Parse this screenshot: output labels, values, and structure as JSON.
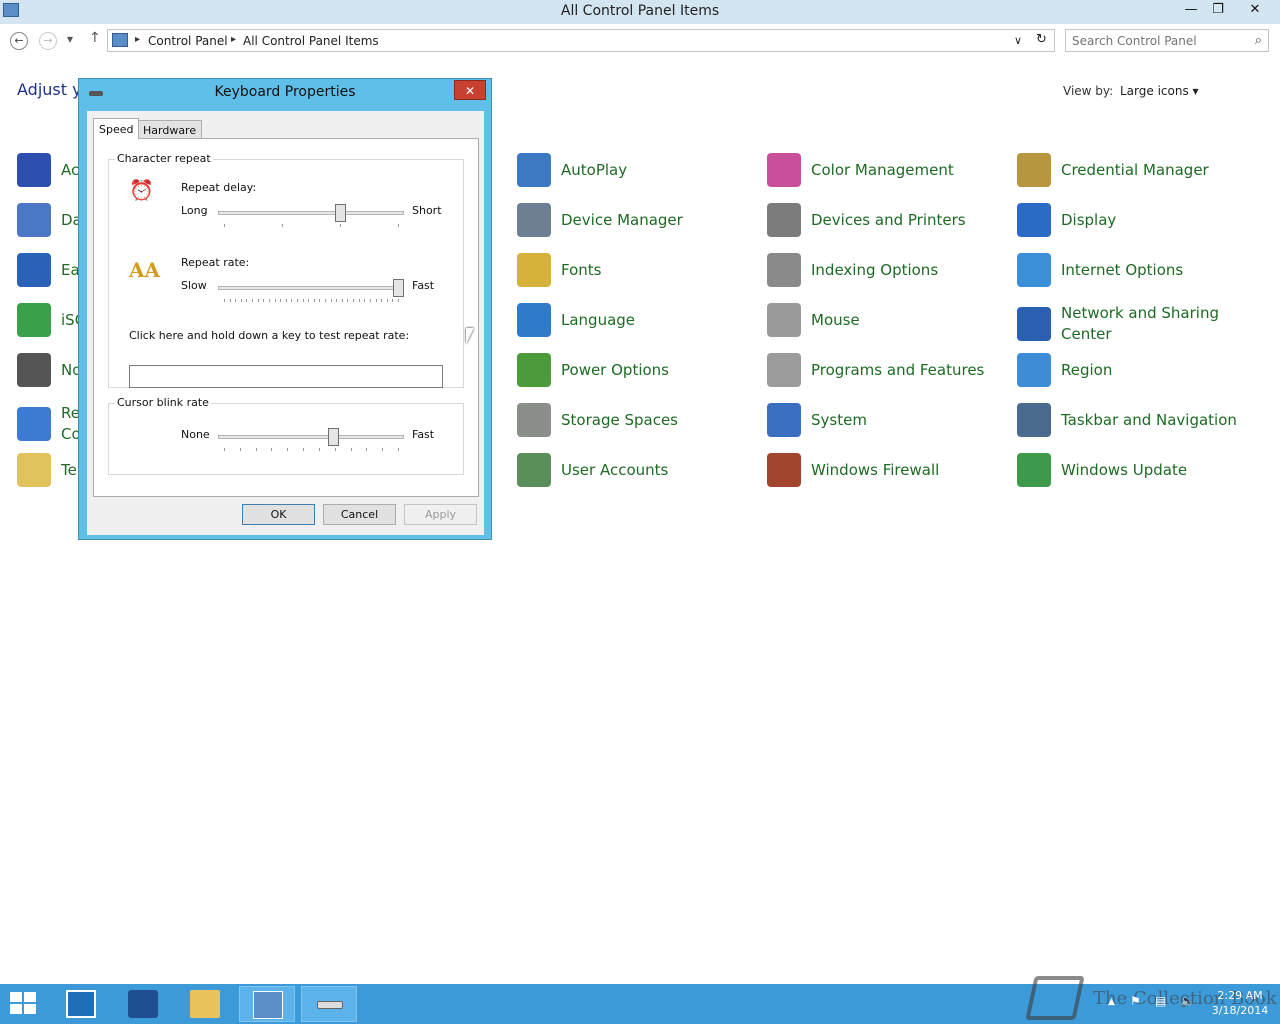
{
  "window": {
    "title": "All Control Panel Items",
    "minimize": "—",
    "restore": "❐",
    "close": "✕"
  },
  "nav": {
    "back": "←",
    "forward": "→",
    "recent": "▾",
    "up": "↑"
  },
  "address": {
    "crumbs": [
      "Control Panel",
      "All Control Panel Items"
    ],
    "separator": "▸",
    "dropdown": "∨",
    "refresh": "↻"
  },
  "search": {
    "placeholder": "Search Control Panel",
    "icon": "⌕"
  },
  "content": {
    "heading": "Adjust yo",
    "view_by_label": "View by:",
    "view_by_value": "Large icons ▾"
  },
  "left_items": [
    {
      "label": "Ac",
      "color": "#2d4fb0",
      "icon": "action-center-flag-icon"
    },
    {
      "label": "Da",
      "color": "#4a78c7",
      "icon": "date-time-calendar-icon"
    },
    {
      "label": "Ea",
      "color": "#2a62b8",
      "icon": "ease-of-access-icon"
    },
    {
      "label": "iSC",
      "color": "#3aa04a",
      "icon": "iscsi-initiator-globe-icon"
    },
    {
      "label": "No",
      "color": "#555555",
      "icon": "notification-area-icon"
    },
    {
      "label": "Re",
      "label2": "Co",
      "color": "#3b7bd1",
      "icon": "remote-app-icon"
    },
    {
      "label": "Te",
      "color": "#e2c25a",
      "icon": "text-to-speech-icon"
    }
  ],
  "grid_items": [
    {
      "label": "AutoPlay",
      "color": "#3d78c3",
      "icon": "autoplay-icon"
    },
    {
      "label": "Color Management",
      "color": "#c94f9d",
      "icon": "color-management-icon"
    },
    {
      "label": "Credential Manager",
      "color": "#b8963f",
      "icon": "credential-manager-icon"
    },
    {
      "label": "Device Manager",
      "color": "#6d7f93",
      "icon": "device-manager-icon"
    },
    {
      "label": "Devices and Printers",
      "color": "#7c7c7c",
      "icon": "devices-printers-icon"
    },
    {
      "label": "Display",
      "color": "#2a6bc5",
      "icon": "display-monitor-icon"
    },
    {
      "label": "Fonts",
      "color": "#d7b23a",
      "icon": "fonts-folder-icon"
    },
    {
      "label": "Indexing Options",
      "color": "#8a8a8a",
      "icon": "indexing-magnifier-icon"
    },
    {
      "label": "Internet Options",
      "color": "#3b8fd8",
      "icon": "internet-options-globe-icon"
    },
    {
      "label": "Language",
      "color": "#2f7ac9",
      "icon": "language-globe-icon"
    },
    {
      "label": "Mouse",
      "color": "#9a9a9a",
      "icon": "mouse-icon"
    },
    {
      "label": "Network and Sharing Center",
      "color": "#2b5fb0",
      "icon": "network-sharing-icon"
    },
    {
      "label": "Power Options",
      "color": "#4c9b3b",
      "icon": "power-battery-icon"
    },
    {
      "label": "Programs and Features",
      "color": "#9b9b9b",
      "icon": "programs-features-icon"
    },
    {
      "label": "Region",
      "color": "#3e8bd6",
      "icon": "region-globe-clock-icon"
    },
    {
      "label": "Storage Spaces",
      "color": "#8a8f8a",
      "icon": "storage-spaces-icon"
    },
    {
      "label": "System",
      "color": "#3a6fc0",
      "icon": "system-computer-icon"
    },
    {
      "label": "Taskbar and Navigation",
      "color": "#4a6a8f",
      "icon": "taskbar-navigation-icon"
    },
    {
      "label": "User Accounts",
      "color": "#5a8f5a",
      "icon": "user-accounts-icon"
    },
    {
      "label": "Windows Firewall",
      "color": "#a2452e",
      "icon": "windows-firewall-icon"
    },
    {
      "label": "Windows Update",
      "color": "#3c9a4a",
      "icon": "windows-update-icon"
    }
  ],
  "dialog": {
    "title": "Keyboard Properties",
    "close": "✕",
    "tabs": [
      "Speed",
      "Hardware"
    ],
    "character_repeat": {
      "group_title": "Character repeat",
      "delay_label": "Repeat delay:",
      "delay_min": "Long",
      "delay_max": "Short",
      "delay_value_fraction": 0.67,
      "delay_ticks": 4,
      "rate_label": "Repeat rate:",
      "rate_min": "Slow",
      "rate_max": "Fast",
      "rate_value_fraction": 1.0,
      "rate_ticks": 32,
      "test_label": "Click here and hold down a key to test repeat rate:",
      "test_value": ""
    },
    "cursor_blink": {
      "group_title": "Cursor blink rate",
      "min": "None",
      "max": "Fast",
      "value_fraction": 0.63,
      "ticks": 12
    },
    "buttons": {
      "ok": "OK",
      "cancel": "Cancel",
      "apply": "Apply"
    }
  },
  "taskbar": {
    "items": [
      "server-manager-icon",
      "powershell-icon",
      "file-explorer-icon",
      "control-panel-icon",
      "keyboard-icon"
    ],
    "tray_arrow": "▲",
    "time": "2:29 AM",
    "date": "3/18/2014",
    "watermark": "The Collection Book"
  },
  "colors": {
    "accent": "#3c9ad9",
    "dialog_frame": "#5fbfe8",
    "link_green": "#1e6b24",
    "heading_blue": "#1e3287"
  }
}
